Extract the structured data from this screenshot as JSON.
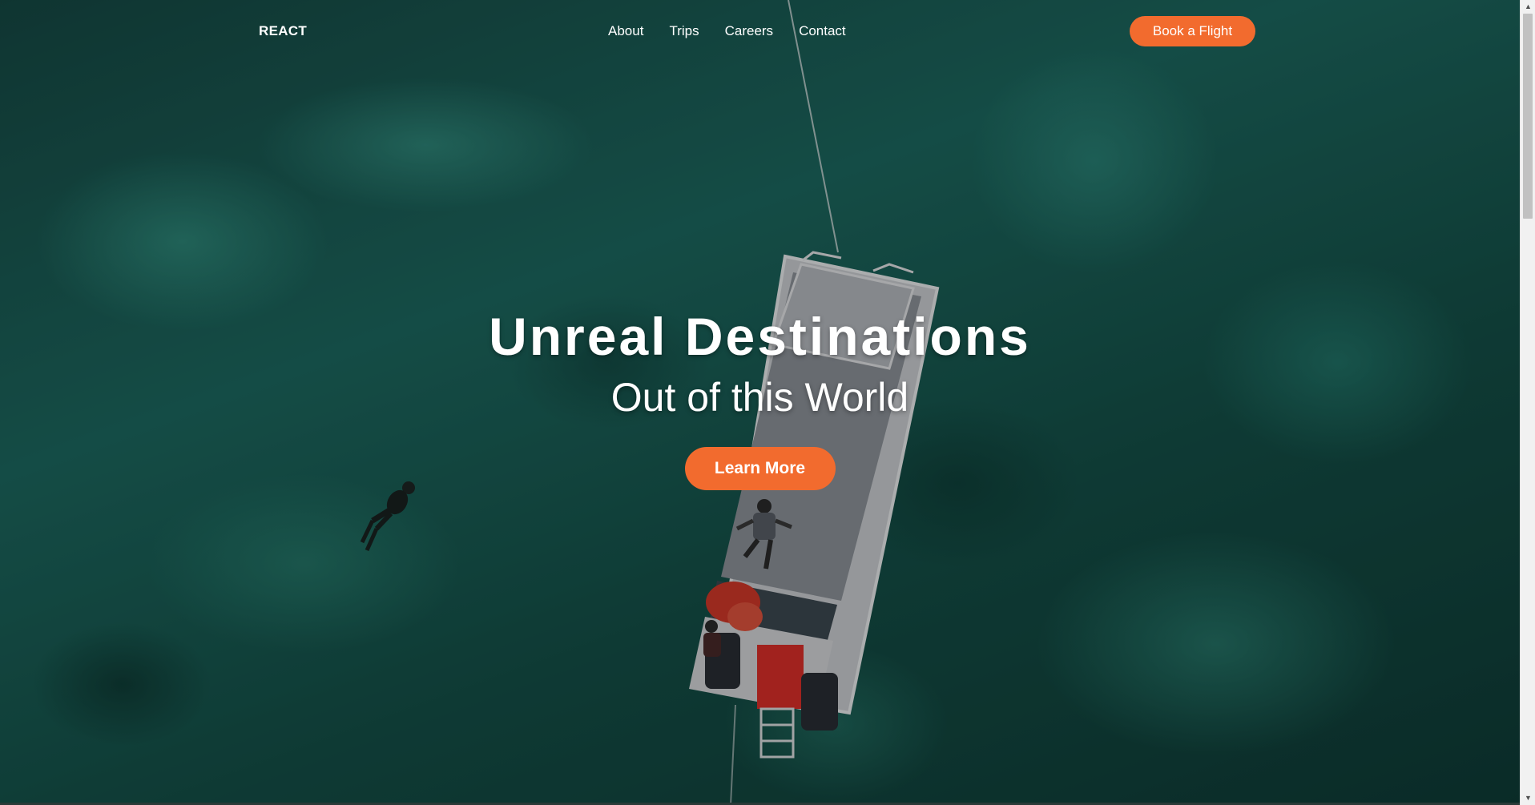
{
  "navbar": {
    "logo": "REACT",
    "links": [
      "About",
      "Trips",
      "Careers",
      "Contact"
    ],
    "cta_label": "Book a Flight"
  },
  "hero": {
    "title": "Unreal Destinations",
    "subtitle": "Out of this World",
    "button_label": "Learn More"
  },
  "colors": {
    "accent": "#f26b2e",
    "text": "#ffffff",
    "ocean": "#1d6a61"
  }
}
